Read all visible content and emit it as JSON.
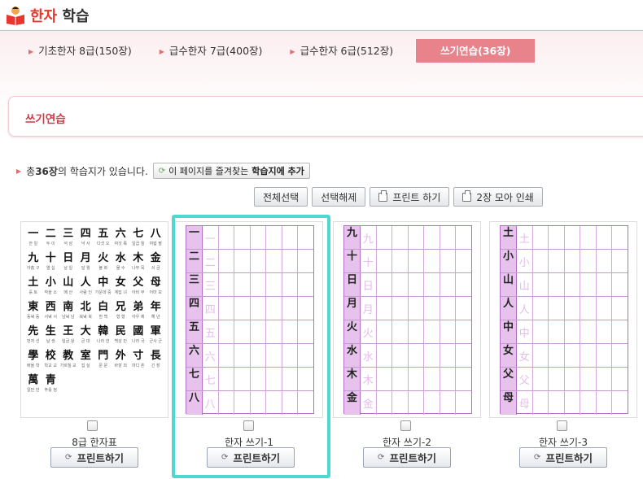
{
  "header": {
    "title_part1": "한자",
    "title_part2": "학습"
  },
  "tabs": [
    {
      "label": "기초한자 8급(150장)",
      "active": false
    },
    {
      "label": "급수한자 7급(400장)",
      "active": false
    },
    {
      "label": "급수한자 6급(512장)",
      "active": false
    },
    {
      "label": "쓰기연습(36장)",
      "active": true
    }
  ],
  "section": {
    "title": "쓰기연습"
  },
  "info": {
    "prefix": "총 ",
    "count": "36장",
    "suffix": "의 학습지가 있습니다.",
    "fav_label_pre": "이 페이지를 즐겨찾는 ",
    "fav_label_bold": "학습지에 추가"
  },
  "actions": {
    "select_all": "전체선택",
    "deselect": "선택해제",
    "print": "프린트 하기",
    "print2": "2장 모아 인쇄"
  },
  "cards": [
    {
      "title": "8급 한자표",
      "button": "프린트하기"
    },
    {
      "title": "한자 쓰기-1",
      "button": "프린트하기"
    },
    {
      "title": "한자 쓰기-2",
      "button": "프린트하기"
    },
    {
      "title": "한자 쓰기-3",
      "button": "프린트하기"
    }
  ],
  "hanja_table": [
    [
      [
        "一",
        "한 일"
      ],
      [
        "二",
        "두 이"
      ],
      [
        "三",
        "석 삼"
      ],
      [
        "四",
        "넉 사"
      ],
      [
        "五",
        "다섯 오"
      ],
      [
        "六",
        "여섯 륙"
      ],
      [
        "七",
        "일곱 칠"
      ],
      [
        "八",
        "여덟 팔"
      ]
    ],
    [
      [
        "九",
        "아홉 구"
      ],
      [
        "十",
        "열 십"
      ],
      [
        "日",
        "날 일"
      ],
      [
        "月",
        "달 월"
      ],
      [
        "火",
        "불 화"
      ],
      [
        "水",
        "물 수"
      ],
      [
        "木",
        "나무 목"
      ],
      [
        "金",
        "쇠 금"
      ]
    ],
    [
      [
        "土",
        "흙 토"
      ],
      [
        "小",
        "작을 소"
      ],
      [
        "山",
        "메 산"
      ],
      [
        "人",
        "사람 인"
      ],
      [
        "中",
        "가운데 중"
      ],
      [
        "女",
        "계집 녀"
      ],
      [
        "父",
        "아비 부"
      ],
      [
        "母",
        "어미 모"
      ]
    ],
    [
      [
        "東",
        "동녘 동"
      ],
      [
        "西",
        "서녘 서"
      ],
      [
        "南",
        "남녘 남"
      ],
      [
        "北",
        "북녘 북"
      ],
      [
        "白",
        "흰 백"
      ],
      [
        "兄",
        "형 형"
      ],
      [
        "弟",
        "아우 제"
      ],
      [
        "年",
        "해 년"
      ]
    ],
    [
      [
        "先",
        "먼저 선"
      ],
      [
        "生",
        "날 생"
      ],
      [
        "王",
        "임금 왕"
      ],
      [
        "大",
        "큰 대"
      ],
      [
        "韓",
        "나라 한"
      ],
      [
        "民",
        "백성 민"
      ],
      [
        "國",
        "나라 국"
      ],
      [
        "軍",
        "군사 군"
      ]
    ],
    [
      [
        "學",
        "배울 학"
      ],
      [
        "校",
        "학교 교"
      ],
      [
        "教",
        "가르칠 교"
      ],
      [
        "室",
        "집 실"
      ],
      [
        "門",
        "문 문"
      ],
      [
        "外",
        "바깥 외"
      ],
      [
        "寸",
        "마디 촌"
      ],
      [
        "長",
        "긴 장"
      ]
    ],
    [
      [
        "萬",
        "일만 만"
      ],
      [
        "青",
        "푸를 청"
      ]
    ]
  ],
  "sheet1": [
    "一",
    "二",
    "三",
    "四",
    "五",
    "六",
    "七",
    "八"
  ],
  "sheet2": [
    "九",
    "十",
    "日",
    "月",
    "火",
    "水",
    "木",
    "金"
  ],
  "sheet3": [
    "土",
    "小",
    "山",
    "人",
    "中",
    "女",
    "父",
    "母"
  ],
  "colors": {
    "accent": "#e8838b",
    "title_red": "#d03846",
    "highlight": "#4fd8cf",
    "grid": "#b06fc0"
  }
}
